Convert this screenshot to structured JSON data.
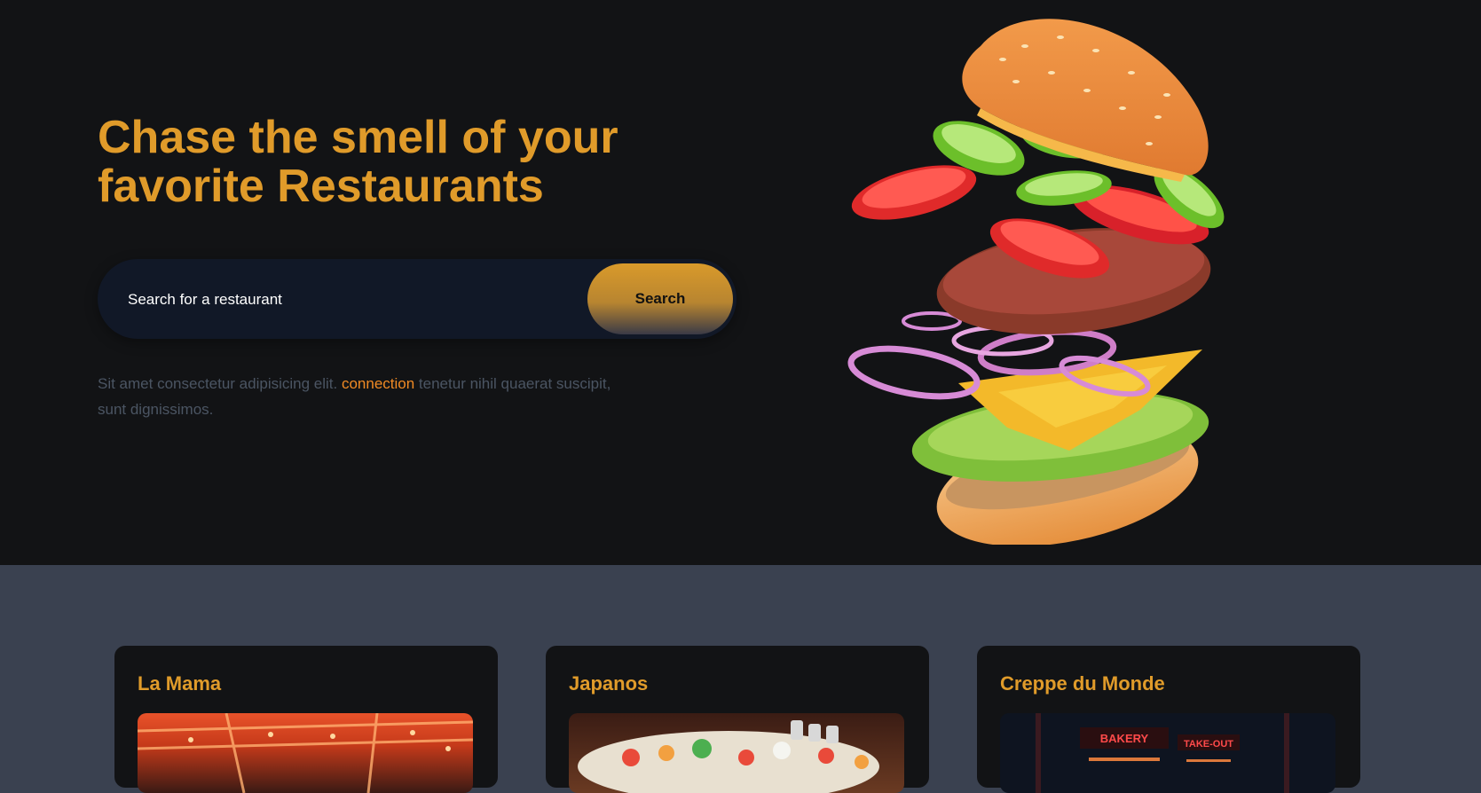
{
  "hero": {
    "headline": "Chase the smell of your favorite Restaurants",
    "search": {
      "placeholder": "Search for a restaurant",
      "button_label": "Search"
    },
    "lede": {
      "before": "Sit amet consectetur adipisicing elit. ",
      "highlight": "connection",
      "after": " tenetur nihil quaerat suscipit, sunt dignissimos."
    }
  },
  "restaurants": [
    {
      "name": "La Mama"
    },
    {
      "name": "Japanos"
    },
    {
      "name": "Creppe du Monde",
      "sign_left": "BAKERY",
      "sign_right": "TAKE-OUT"
    }
  ],
  "colors": {
    "accent": "#e09b2a",
    "highlight": "#f08a24",
    "hero_bg": "#121315",
    "section_bg": "#3a4150",
    "search_bg": "#111827"
  }
}
